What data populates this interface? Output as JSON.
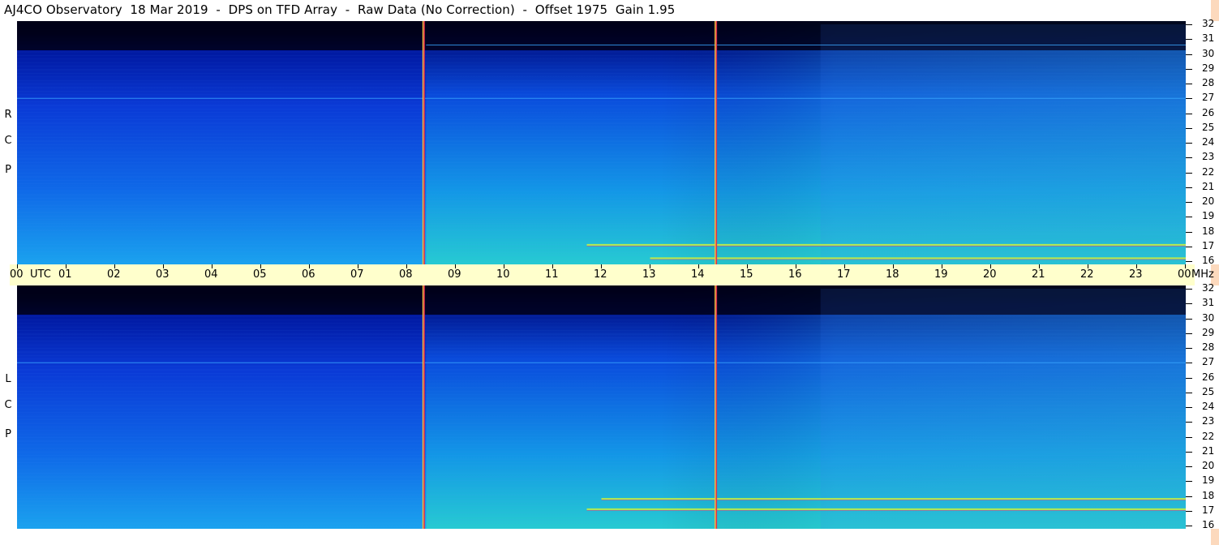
{
  "title": "AJ4CO Observatory  18 Mar 2019  -  DPS on TFD Array  -  Raw Data (No Correction)  -  Offset 1975  Gain 1.95",
  "rcp_label": [
    "R",
    "C",
    "P"
  ],
  "lcp_label": [
    "L",
    "C",
    "P"
  ],
  "time_ticks": [
    "00",
    "01",
    "02",
    "03",
    "04",
    "05",
    "06",
    "07",
    "08",
    "09",
    "10",
    "11",
    "12",
    "13",
    "14",
    "15",
    "16",
    "17",
    "18",
    "19",
    "20",
    "21",
    "22",
    "23",
    "00"
  ],
  "utc_label": "UTC",
  "mhz_label": "MHz",
  "freq_ticks": [
    "32",
    "31",
    "30",
    "29",
    "28",
    "27",
    "26",
    "25",
    "24",
    "23",
    "22",
    "21",
    "20",
    "19",
    "18",
    "17",
    "16"
  ],
  "colors": {
    "axis_band": "#ffffcc",
    "right_strip": "#fcd9bd",
    "low": "#000022",
    "mid": "#0a3ad6",
    "high": "#2fe0c0"
  },
  "chart_data": [
    {
      "type": "heatmap",
      "title": "AJ4CO Observatory  18 Mar 2019  -  DPS on TFD Array  -  Raw Data (No Correction)  -  Offset 1975  Gain 1.95",
      "series_label": "R C P",
      "x": {
        "label": "UTC",
        "range": [
          0,
          24
        ],
        "ticks": [
          "00",
          "01",
          "02",
          "03",
          "04",
          "05",
          "06",
          "07",
          "08",
          "09",
          "10",
          "11",
          "12",
          "13",
          "14",
          "15",
          "16",
          "17",
          "18",
          "19",
          "20",
          "21",
          "22",
          "23",
          "00"
        ]
      },
      "y": {
        "label": "MHz",
        "range": [
          16,
          32
        ],
        "ticks": [
          16,
          17,
          18,
          19,
          20,
          21,
          22,
          23,
          24,
          25,
          26,
          27,
          28,
          29,
          30,
          31,
          32
        ]
      },
      "calibration_markers_utc": [
        8.35,
        14.35
      ],
      "features": [
        {
          "type": "interference_band",
          "freq_mhz": 17.1,
          "utc_start": 11.7,
          "utc_end": 24.0
        },
        {
          "type": "interference_band",
          "freq_mhz": 16.2,
          "utc_start": 13.0,
          "utc_end": 24.0
        },
        {
          "type": "interference_band",
          "freq_mhz": 27.0,
          "utc_start": 0.0,
          "utc_end": 24.0
        },
        {
          "type": "interference_band",
          "freq_mhz": 30.6,
          "utc_start": 8.4,
          "utc_end": 24.0
        },
        {
          "type": "brightness_step",
          "utc": 16.5
        }
      ]
    },
    {
      "type": "heatmap",
      "series_label": "L C P",
      "x": {
        "label": "UTC",
        "range": [
          0,
          24
        ],
        "ticks": [
          "00",
          "01",
          "02",
          "03",
          "04",
          "05",
          "06",
          "07",
          "08",
          "09",
          "10",
          "11",
          "12",
          "13",
          "14",
          "15",
          "16",
          "17",
          "18",
          "19",
          "20",
          "21",
          "22",
          "23",
          "00"
        ]
      },
      "y": {
        "label": "MHz",
        "range": [
          16,
          32
        ],
        "ticks": [
          16,
          17,
          18,
          19,
          20,
          21,
          22,
          23,
          24,
          25,
          26,
          27,
          28,
          29,
          30,
          31,
          32
        ]
      },
      "calibration_markers_utc": [
        8.35,
        14.35
      ],
      "features": [
        {
          "type": "interference_band",
          "freq_mhz": 17.1,
          "utc_start": 11.7,
          "utc_end": 24.0
        },
        {
          "type": "interference_band",
          "freq_mhz": 17.8,
          "utc_start": 12.0,
          "utc_end": 24.0
        },
        {
          "type": "interference_band",
          "freq_mhz": 27.0,
          "utc_start": 0.0,
          "utc_end": 24.0
        },
        {
          "type": "brightness_step",
          "utc": 16.5
        }
      ]
    }
  ]
}
